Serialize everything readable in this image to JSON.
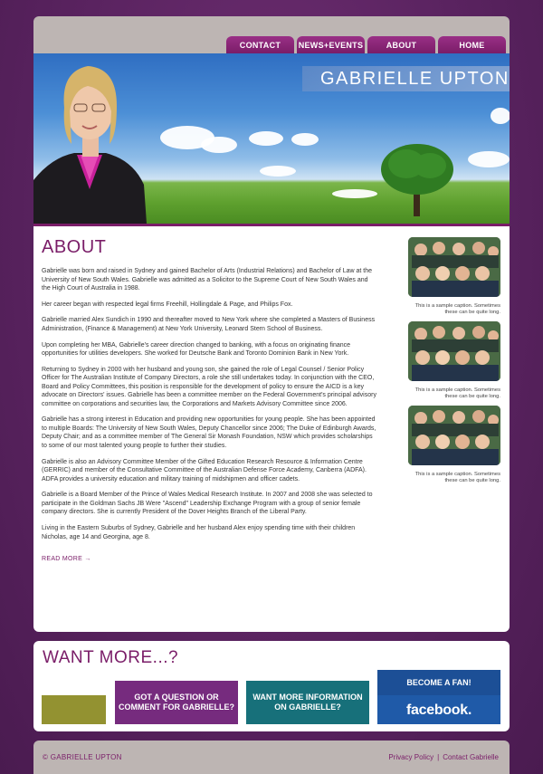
{
  "nav": {
    "items": [
      {
        "label": "CONTACT"
      },
      {
        "label": "NEWS+EVENTS"
      },
      {
        "label": "ABOUT"
      },
      {
        "label": "HOME"
      }
    ]
  },
  "header": {
    "site_title": "GABRIELLE UPTON"
  },
  "about": {
    "title": "ABOUT",
    "paragraphs": [
      "Gabrielle was born and raised in Sydney and gained Bachelor of Arts (Industrial Relations) and Bachelor of Law at the University of New South Wales. Gabrielle was admitted as a Solicitor to the Supreme Court of New South Wales and the High Court of Australia in 1988.",
      "Her career began with respected legal firms Freehill, Hollingdale & Page, and Philips Fox.",
      "Gabrielle married Alex Sundich in 1990 and thereafter moved to New York where she completed a Masters of Business Administration, (Finance & Management) at New York University, Leonard Stern School of Business.",
      "Upon completing her MBA, Gabrielle's career direction changed to banking, with a focus on originating finance opportunities for utilities developers. She worked for Deutsche Bank and Toronto Dominion Bank in New York.",
      "Returning to Sydney in 2000 with her husband and young son, she gained the role of Legal Counsel / Senior Policy Officer for The Australian Institute of Company Directors, a role she still undertakes today. In conjunction with the CEO, Board and Policy Committees, this position is responsible for the development of policy to ensure the AICD is a key advocate on Directors' issues. Gabrielle has been a committee member on the Federal Government's principal advisory committee on corporations and securities law, the Corporations and Markets Advisory Committee since 2006.",
      "Gabrielle has a strong interest in Education and providing new opportunities for young people. She has been appointed to multiple Boards: The University of New South Wales, Deputy Chancellor since 2006; The Duke of Edinburgh Awards, Deputy Chair; and as a committee member of The General Sir Monash Foundation, NSW which provides scholarships to some of our most talented young people to further their studies.",
      "Gabrielle is also an Advisory Committee Member of the Gifted Education Research Resource & Information Centre (GERRIC) and member of the Consultative Committee of the Australian Defense Force Academy, Canberra (ADFA). ADFA provides a university education and military training of midshipmen and officer cadets.",
      "Gabrielle is a Board Member of the Prince of Wales Medical Research Institute. In 2007 and 2008 she was selected to participate in the Goldman Sachs JB Were \"Ascend\" Leadership Exchange Program with a group of senior female company directors. She is currently President of the Dover Heights Branch of the Liberal Party.",
      "Living in the Eastern Suburbs of Sydney, Gabrielle and her husband Alex enjoy spending time with their children Nicholas, age 14 and Georgina, age 8."
    ],
    "read_more": "READ MORE →"
  },
  "sidebar": {
    "photos": [
      {
        "caption": "This is a sample caption. Sometimes these can be quite long."
      },
      {
        "caption": "This is a sample caption. Sometimes these can be quite long."
      },
      {
        "caption": "This is a sample caption. Sometimes these can be quite long."
      }
    ]
  },
  "want_more": {
    "title": "WANT MORE...?",
    "question_label": "GOT A QUESTION OR COMMENT FOR GABRIELLE?",
    "info_label": "WANT MORE INFORMATION ON GABRIELLE?",
    "fan_label": "BECOME A FAN!",
    "facebook_label": "facebook."
  },
  "footer": {
    "copyright": "© GABRIELLE UPTON",
    "privacy": "Privacy Policy",
    "separator": "|",
    "contact": "Contact Gabrielle"
  },
  "colors": {
    "brand_purple": "#7a1d68",
    "olive": "#939231",
    "teal": "#17707a",
    "facebook_blue": "#1f5aa8"
  }
}
